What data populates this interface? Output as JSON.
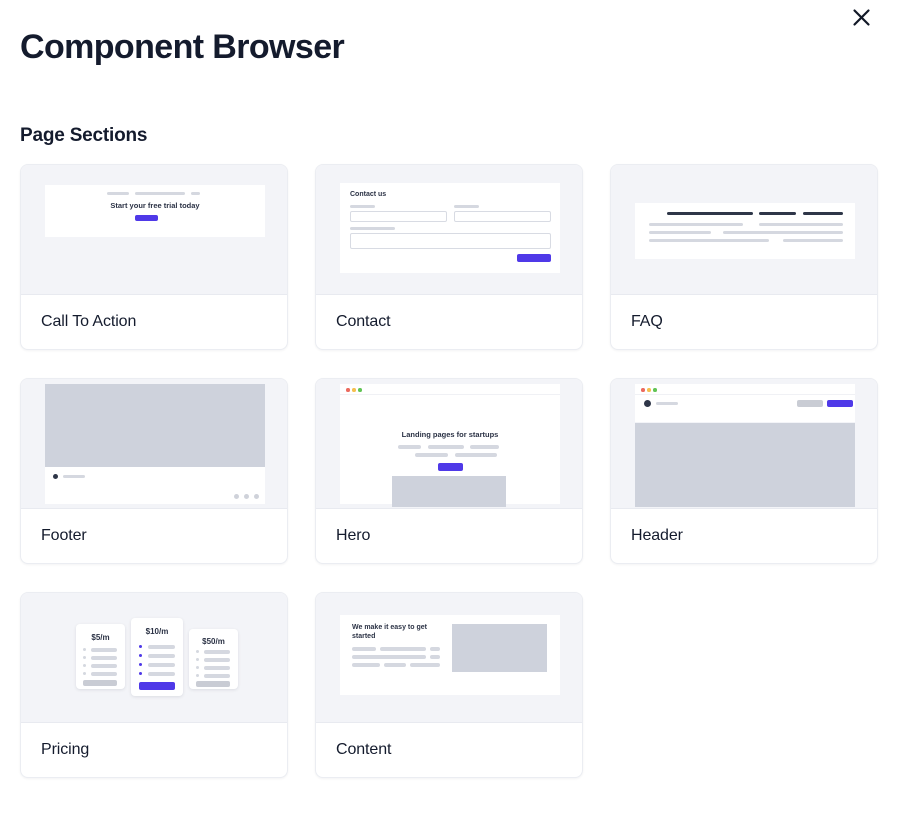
{
  "window": {
    "title": "Component Browser",
    "close_icon": "close-icon"
  },
  "sections": [
    {
      "heading": "Page Sections",
      "cards": [
        {
          "label": "Call To Action",
          "preview": {
            "type": "call-to-action",
            "headline": "Start your free trial today",
            "button_color": "#4f39e8"
          }
        },
        {
          "label": "Contact",
          "preview": {
            "type": "contact",
            "headline": "Contact us",
            "fields": 3,
            "submit_color": "#4f39e8"
          }
        },
        {
          "label": "FAQ",
          "preview": {
            "type": "faq",
            "columns": 2,
            "heading_color": "#2e3648"
          }
        },
        {
          "label": "Footer",
          "preview": {
            "type": "footer",
            "social_dots": 3
          }
        },
        {
          "label": "Hero",
          "preview": {
            "type": "hero",
            "headline": "Landing pages for startups",
            "button_color": "#4f39e8"
          }
        },
        {
          "label": "Header",
          "preview": {
            "type": "header",
            "cta_color": "#4f39e8"
          }
        },
        {
          "label": "Pricing",
          "preview": {
            "type": "pricing",
            "tiers": [
              {
                "price": "$5/m",
                "featured": false
              },
              {
                "price": "$10/m",
                "featured": true
              },
              {
                "price": "$50/m",
                "featured": false
              }
            ]
          }
        },
        {
          "label": "Content",
          "preview": {
            "type": "content",
            "headline": "We make it easy to get started"
          }
        }
      ]
    }
  ],
  "theme": {
    "accent": "#4f39e8",
    "text_dark": "#141b2d",
    "thumb_bg": "#f3f4f8",
    "placeholder_gray": "#d5d8e0",
    "block_gray": "#ced2dc"
  }
}
